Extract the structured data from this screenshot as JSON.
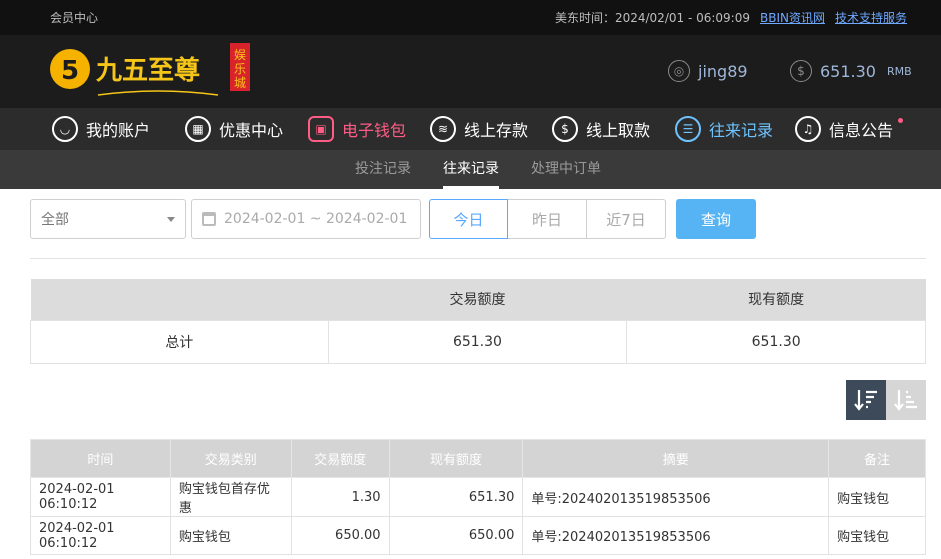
{
  "topbar": {
    "member_center": "会员中心",
    "time_label": "美东时间：2024/02/01 - 06:09:09",
    "link1": "BBIN资讯网",
    "link2": "技术支持服务"
  },
  "header": {
    "logo_text": "九五至尊",
    "logo_sub": "娱乐城",
    "username": "jing89",
    "balance": "651.30",
    "currency": "RMB"
  },
  "nav": [
    {
      "label": "我的账户",
      "icon": "user-icon"
    },
    {
      "label": "优惠中心",
      "icon": "gift-icon"
    },
    {
      "label": "电子钱包",
      "icon": "wallet-icon"
    },
    {
      "label": "线上存款",
      "icon": "deposit-icon"
    },
    {
      "label": "线上取款",
      "icon": "withdraw-icon"
    },
    {
      "label": "往来记录",
      "icon": "record-icon"
    },
    {
      "label": "信息公告",
      "icon": "bell-icon"
    }
  ],
  "subnav": {
    "tab1": "投注记录",
    "tab2": "往来记录",
    "tab3": "处理中订单"
  },
  "filters": {
    "select_value": "全部",
    "date_range": "2024-02-01 ~ 2024-02-01",
    "today": "今日",
    "yesterday": "昨日",
    "last7": "近7日",
    "query": "查询"
  },
  "summary": {
    "h_amount": "交易额度",
    "h_current": "现有额度",
    "row_label": "总计",
    "amount": "651.30",
    "current": "651.30"
  },
  "detail": {
    "headers": [
      "时间",
      "交易类别",
      "交易额度",
      "现有额度",
      "摘要",
      "备注"
    ],
    "rows": [
      [
        "2024-02-01 06:10:12",
        "购宝钱包首存优惠",
        "1.30",
        "651.30",
        "单号:202402013519853506",
        "购宝钱包"
      ],
      [
        "2024-02-01 06:10:12",
        "购宝钱包",
        "650.00",
        "650.00",
        "单号:202402013519853506",
        "购宝钱包"
      ]
    ]
  },
  "colors": {
    "accent": "#56b4f5",
    "pink": "#ff5c86"
  }
}
